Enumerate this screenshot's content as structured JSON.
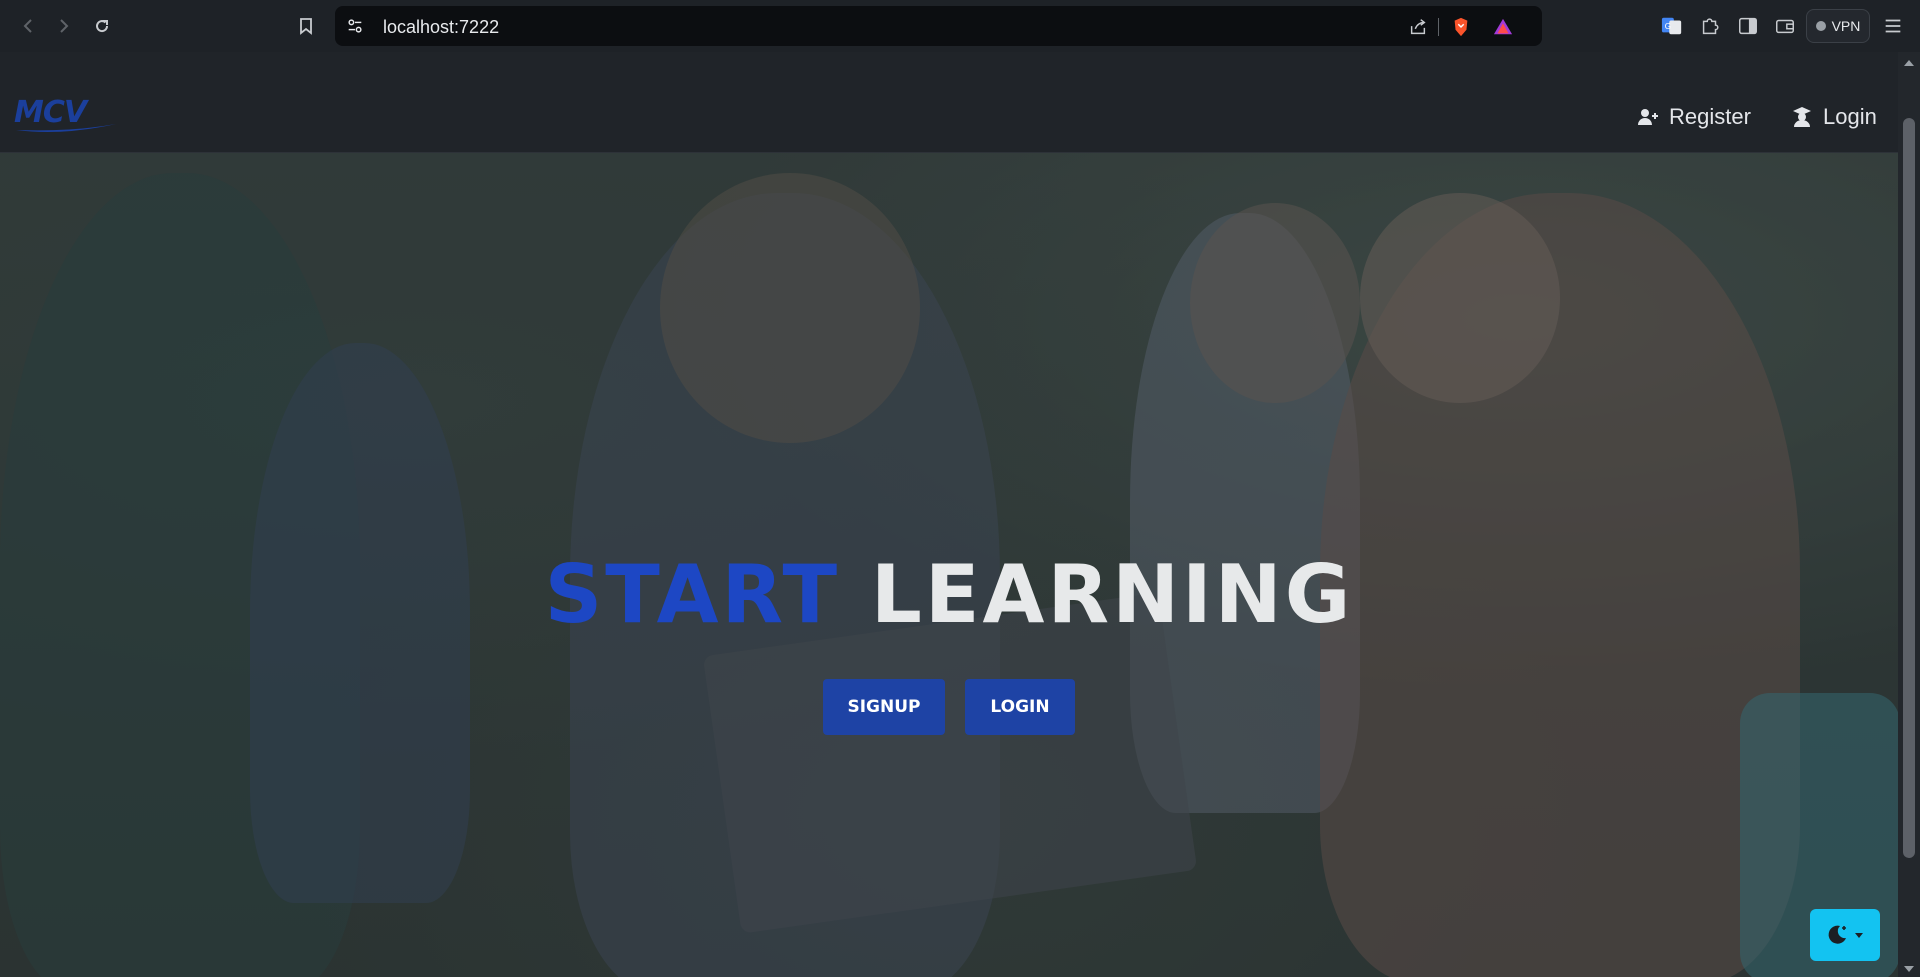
{
  "browser": {
    "url": "localhost:7222",
    "vpn_label": "VPN"
  },
  "header": {
    "logo_text": "MCV",
    "register_label": "Register",
    "login_label": "Login"
  },
  "hero": {
    "title_word1": "START",
    "title_word2": "LEARNING",
    "signup_label": "SIGNUP",
    "login_label": "LOGIN"
  },
  "colors": {
    "accent_blue": "#1e43a5",
    "title_blue": "#1d47c4",
    "toggle_cyan": "#13c3f1",
    "header_bg": "#202429"
  },
  "icons": {
    "back": "arrow-left-icon",
    "forward": "arrow-right-icon",
    "reload": "reload-icon",
    "bookmark": "bookmark-icon",
    "site_settings": "tune-icon",
    "share": "share-icon",
    "brave": "brave-shield-icon",
    "rewards": "brave-rewards-icon",
    "translate": "translate-icon",
    "extensions": "puzzle-icon",
    "sidebar": "sidebar-icon",
    "wallet": "wallet-icon",
    "menu": "hamburger-menu-icon",
    "register": "user-plus-icon",
    "login": "graduate-icon",
    "theme": "moon-icon"
  }
}
